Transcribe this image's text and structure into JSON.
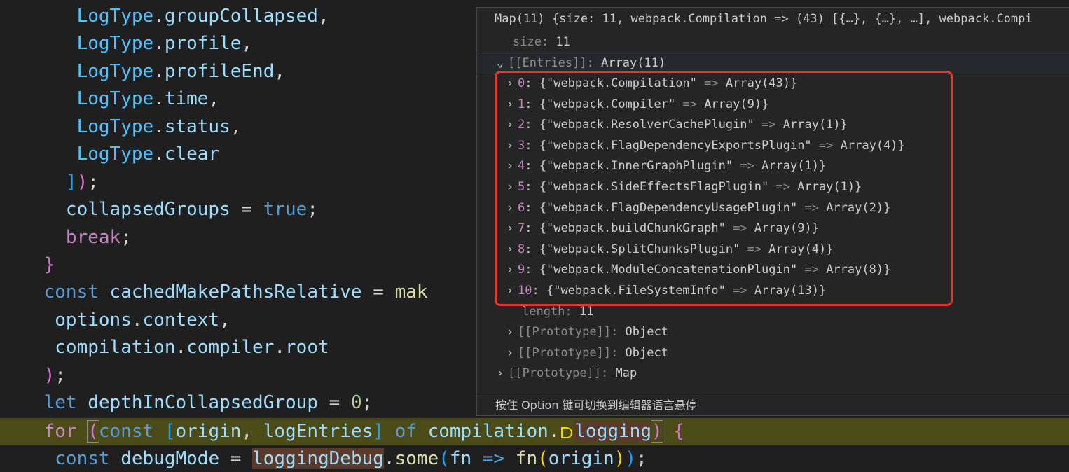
{
  "code": {
    "lines": [
      {
        "indent": "       ",
        "obj": "LogType",
        "dot": ".",
        "prop": "groupCollapsed",
        "tail": ","
      },
      {
        "indent": "       ",
        "obj": "LogType",
        "dot": ".",
        "prop": "profile",
        "tail": ","
      },
      {
        "indent": "       ",
        "obj": "LogType",
        "dot": ".",
        "prop": "profileEnd",
        "tail": ","
      },
      {
        "indent": "       ",
        "obj": "LogType",
        "dot": ".",
        "prop": "time",
        "tail": ","
      },
      {
        "indent": "       ",
        "obj": "LogType",
        "dot": ".",
        "prop": "status",
        "tail": ","
      },
      {
        "indent": "       ",
        "obj": "LogType",
        "dot": ".",
        "prop": "clear",
        "tail": ""
      }
    ],
    "close_array": {
      "indent": "      ",
      "bracket": "]",
      "paren": ")",
      "semi": ";"
    },
    "collapsed": {
      "indent": "      ",
      "name": "collapsedGroups",
      "op": " = ",
      "value": "true",
      "semi": ";"
    },
    "break_stmt": {
      "indent": "      ",
      "kw": "break",
      "semi": ";"
    },
    "close_brace": {
      "indent": "    ",
      "brace": "}"
    },
    "cached": {
      "indent": "    ",
      "kw": "const",
      "name": " cachedMakePathsRelative",
      "op": " = ",
      "call": "mak"
    },
    "arg1": {
      "indent": "     ",
      "obj": "options",
      "dot": ".",
      "prop": "context",
      "tail": ","
    },
    "arg2": {
      "indent": "     ",
      "obj": "compilation",
      "dot1": ".",
      "prop1": "compiler",
      "dot2": ".",
      "prop2": "root"
    },
    "close_call": {
      "indent": "    ",
      "paren": ")",
      "semi": ";"
    },
    "depth": {
      "indent": "    ",
      "kw": "let",
      "name": " depthInCollapsedGroup",
      "op": " = ",
      "value": "0",
      "semi": ";"
    },
    "for_line": {
      "indent": "    ",
      "kw": "for",
      "sp": " ",
      "open": "(",
      "kw2": "const",
      "sp2": " ",
      "lb": "[",
      "a": "origin",
      "comma": ", ",
      "b": "logEntries",
      "rb": "]",
      "of": " of ",
      "obj": "compilation",
      "dot": ".",
      "prop": "logging",
      "close": ")",
      "brace": " {"
    },
    "debug_line": {
      "indent": "     ",
      "kw": "const",
      "name": " debugMode",
      "op": " = ",
      "obj": "loggingDebug",
      "dot": ".",
      "fn": "some",
      "open": "(",
      "arg": "fn",
      "arrow": " => ",
      "call": "fn",
      "open2": "(",
      "arg2": "origin",
      "close2": ")",
      "close": ")",
      "semi": ";"
    }
  },
  "hover": {
    "title": "Map(11) {size: 11, webpack.Compilation => (43) [{…}, {…}, …], webpack.Compi",
    "size_key": "size",
    "size_value": "11",
    "entries_key": "[[Entries]]",
    "entries_value": "Array(11)",
    "entries": [
      {
        "index": "0",
        "name": "\"webpack.Compilation\"",
        "value": "Array(43)"
      },
      {
        "index": "1",
        "name": "\"webpack.Compiler\"",
        "value": "Array(9)"
      },
      {
        "index": "2",
        "name": "\"webpack.ResolverCachePlugin\"",
        "value": "Array(1)"
      },
      {
        "index": "3",
        "name": "\"webpack.FlagDependencyExportsPlugin\"",
        "value": "Array(4)"
      },
      {
        "index": "4",
        "name": "\"webpack.InnerGraphPlugin\"",
        "value": "Array(1)"
      },
      {
        "index": "5",
        "name": "\"webpack.SideEffectsFlagPlugin\"",
        "value": "Array(1)"
      },
      {
        "index": "6",
        "name": "\"webpack.FlagDependencyUsagePlugin\"",
        "value": "Array(2)"
      },
      {
        "index": "7",
        "name": "\"webpack.buildChunkGraph\"",
        "value": "Array(9)"
      },
      {
        "index": "8",
        "name": "\"webpack.SplitChunksPlugin\"",
        "value": "Array(4)"
      },
      {
        "index": "9",
        "name": "\"webpack.ModuleConcatenationPlugin\"",
        "value": "Array(8)"
      },
      {
        "index": "10",
        "name": "\"webpack.FileSystemInfo\"",
        "value": "Array(13)"
      }
    ],
    "arrow": "=>",
    "length_key": "length",
    "length_value": "11",
    "proto_key": "[[Prototype]]",
    "proto1_value": "Object",
    "proto2_value": "Object",
    "proto3_value": "Map",
    "footer": "按住 Option 键可切换到编辑器语言悬停"
  },
  "colors": {
    "background": "#1f1f1f",
    "current_line": "#4b4b18",
    "highlight_box": "#e8362f",
    "focus_outline": "#007fd4"
  },
  "icons": {
    "chevron_right": "›",
    "chevron_down": "⌄",
    "breakpoint_step": "debug-step-icon"
  }
}
